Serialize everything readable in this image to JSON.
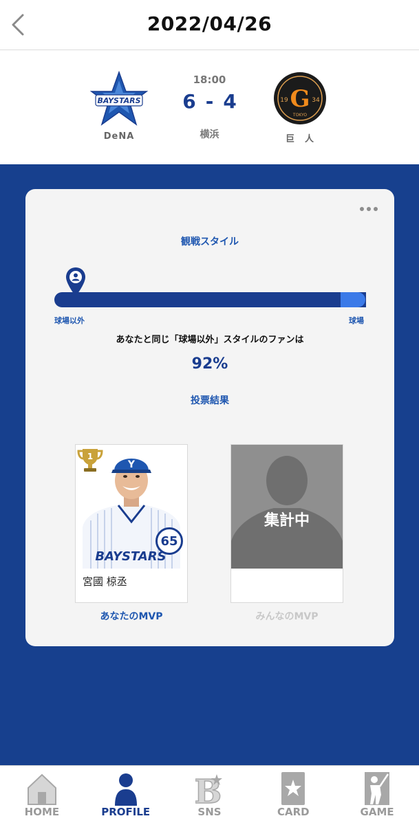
{
  "header": {
    "title": "2022/04/26",
    "back_icon": "chevron-left-icon"
  },
  "game": {
    "time": "18:00",
    "home_score": "6",
    "separator": "-",
    "away_score": "4",
    "venue": "横浜",
    "home_team": {
      "name": "DeNA",
      "logo": "baystars-logo",
      "logo_text": "BAYSTARS"
    },
    "away_team": {
      "name": "巨　人",
      "logo": "giants-logo",
      "logo_left": "19",
      "logo_right": "34",
      "logo_bottom": "TOKYO"
    }
  },
  "card": {
    "menu_icon": "more-dots-icon",
    "style_title": "観戦スタイル",
    "bar_left_label": "球場以外",
    "bar_right_label": "球場",
    "bar_value_percent": 92,
    "fan_text": "あなたと同じ「球場以外」スタイルのファンは",
    "percent": "92%",
    "vote_title": "投票結果",
    "your_mvp": {
      "label": "あなたのMVP",
      "player_name": "宮國 椋丞",
      "number": "65",
      "rank_icon": "trophy-icon",
      "rank": "1",
      "jersey_text": "BAYSTARS",
      "cap_letter": "Y"
    },
    "everyone_mvp": {
      "label": "みんなのMVP",
      "status": "集計中"
    }
  },
  "nav": {
    "items": [
      {
        "label": "HOME",
        "icon": "home-icon",
        "active": false
      },
      {
        "label": "PROFILE",
        "icon": "profile-icon",
        "active": true
      },
      {
        "label": "SNS",
        "icon": "sns-b-icon",
        "active": false
      },
      {
        "label": "CARD",
        "icon": "card-star-icon",
        "active": false
      },
      {
        "label": "GAME",
        "icon": "game-batter-icon",
        "active": false
      }
    ]
  },
  "colors": {
    "brand_blue": "#1a3d8f",
    "accent_blue": "#3b7ae8",
    "background_blue": "#17408e",
    "inactive_gray": "#9a9a9a"
  }
}
